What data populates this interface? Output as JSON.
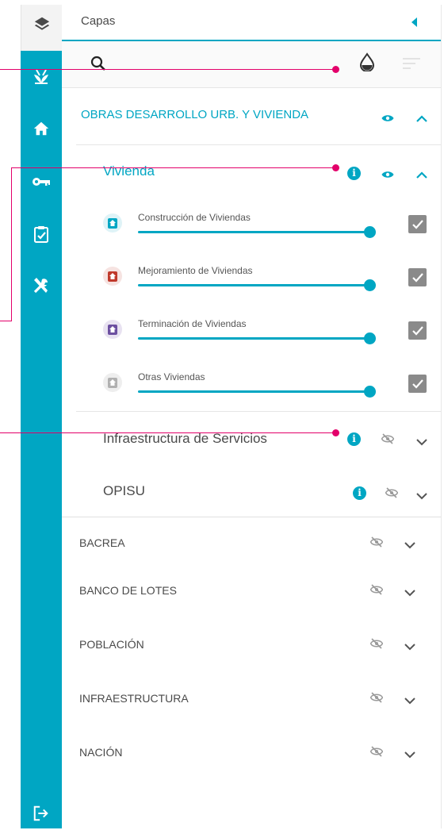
{
  "panel": {
    "title": "Capas"
  },
  "colors": {
    "accent": "#00a6c3",
    "callout": "#e3006a",
    "checkbox": "#8a8a8a",
    "construction_icon": "#00a6c3",
    "improvement_icon": "#c0392b",
    "termination_icon": "#6c4fa0",
    "other_icon": "#b0b0b0"
  },
  "rail": {
    "icons": [
      "layers-icon",
      "sprout-icon",
      "home-icon",
      "key-icon",
      "clipboard-check-icon",
      "tools-icon",
      "logout-icon"
    ]
  },
  "toolbar": {
    "icons": [
      "search-icon",
      "opacity-drop-icon",
      "filter-lines-icon"
    ]
  },
  "group_main": {
    "label": "OBRAS DESARROLLO URB. Y VIVIENDA",
    "visible": true,
    "expanded": true
  },
  "subgroup_vivienda": {
    "label": "Vivienda",
    "visible": true,
    "expanded": true,
    "has_info": true,
    "layers": [
      {
        "label": "Construcción de Viviendas",
        "checked": true,
        "opacity": 1.0
      },
      {
        "label": "Mejoramiento de Viviendas",
        "checked": true,
        "opacity": 1.0
      },
      {
        "label": "Terminación de Viviendas",
        "checked": true,
        "opacity": 1.0
      },
      {
        "label": "Otras Viviendas",
        "checked": true,
        "opacity": 1.0
      }
    ]
  },
  "subgroups_collapsed": [
    {
      "label": "Infraestructura de Servicios",
      "has_info": true,
      "visible": false,
      "expanded": false
    },
    {
      "label": "OPISU",
      "has_info": true,
      "visible": false,
      "expanded": false
    }
  ],
  "groups_collapsed": [
    {
      "label": "BACREA",
      "visible": false,
      "expanded": false
    },
    {
      "label": "BANCO DE LOTES",
      "visible": false,
      "expanded": false
    },
    {
      "label": "POBLACIÓN",
      "visible": false,
      "expanded": false
    },
    {
      "label": "INFRAESTRUCTURA",
      "visible": false,
      "expanded": false
    },
    {
      "label": "NACIÓN",
      "visible": false,
      "expanded": false
    }
  ]
}
